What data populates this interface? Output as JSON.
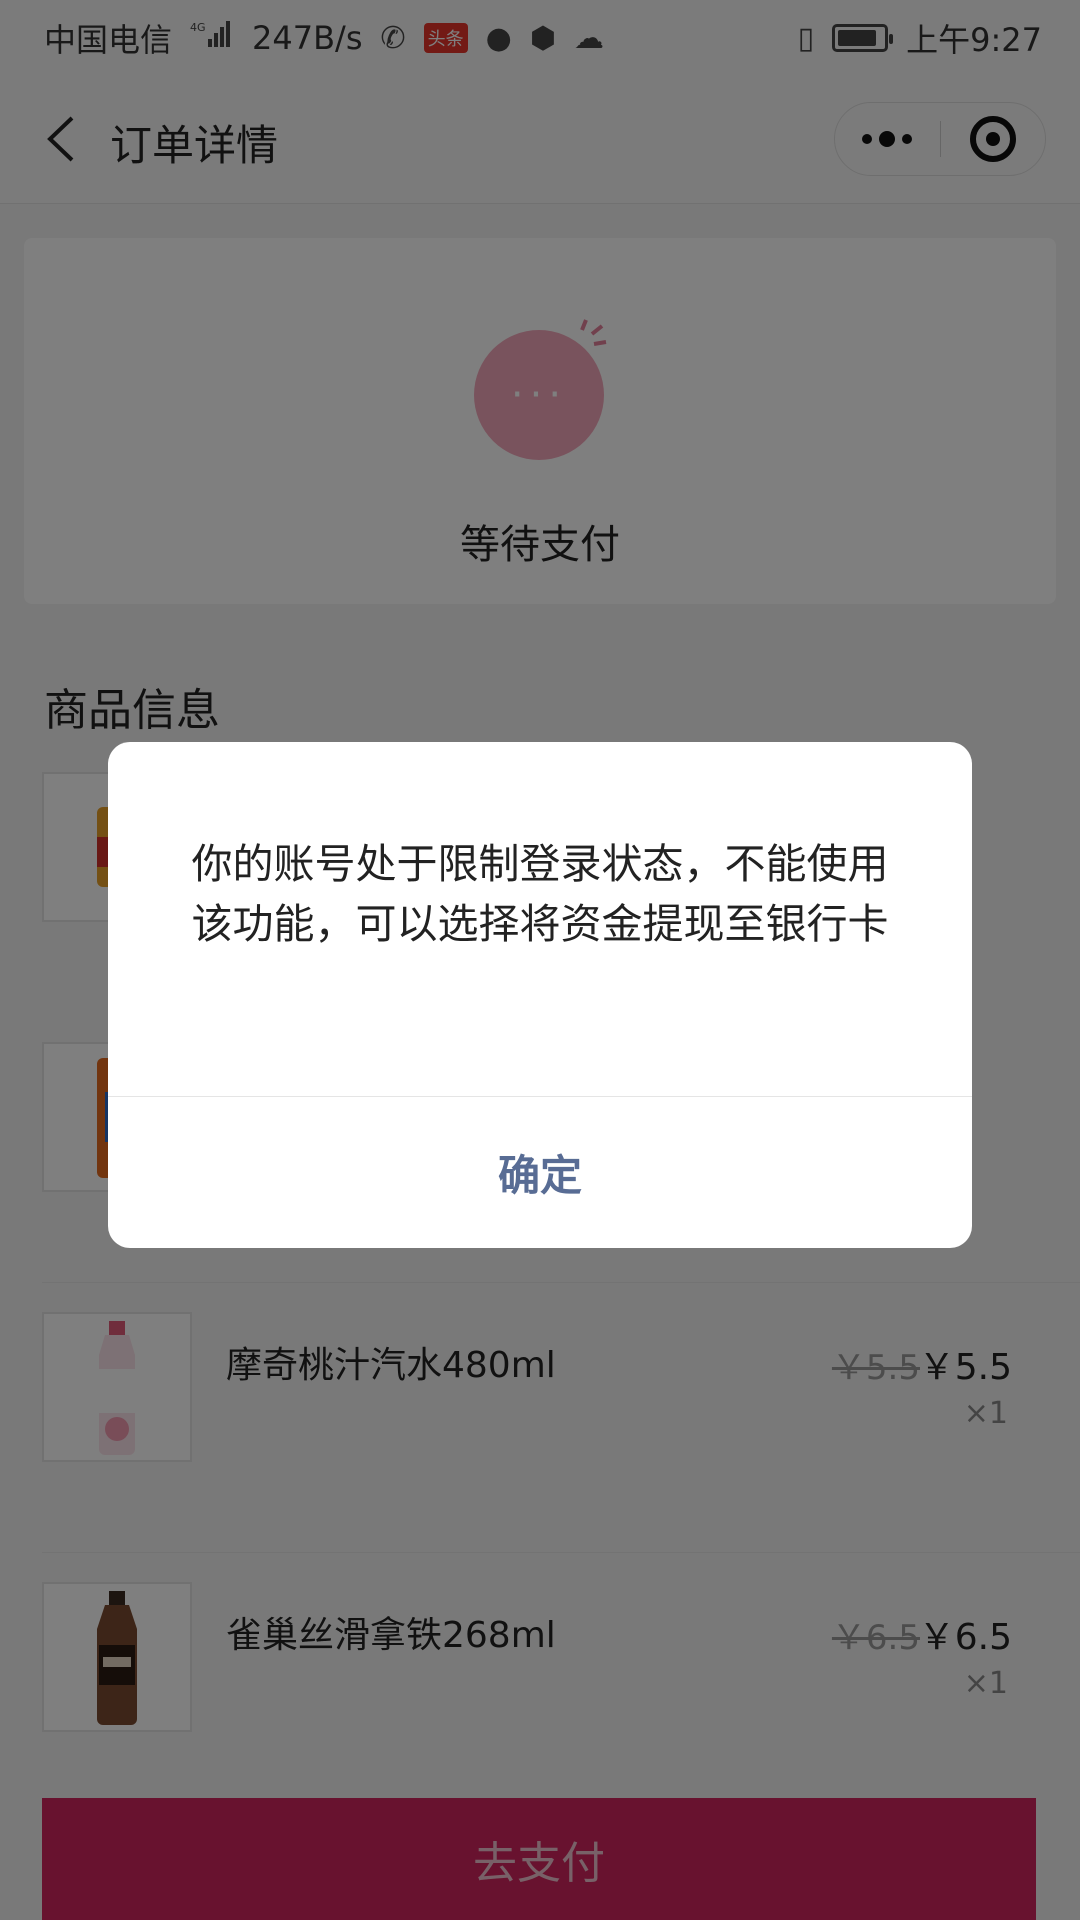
{
  "status_bar": {
    "carrier": "中国电信",
    "network": "4G",
    "speed": "247B/s",
    "badge": "头条",
    "time": "上午9:27",
    "battery_level": 0.85
  },
  "nav": {
    "title": "订单详情",
    "back_icon": "chevron-left-icon",
    "more_icon": "more-icon",
    "close_icon": "target-close-icon"
  },
  "order_status": {
    "icon_text": "···",
    "label": "等待支付"
  },
  "products": {
    "section_title": "商品信息",
    "items": [
      {
        "name": "摩奇桃汁汽水480ml",
        "old_price": "￥5.5",
        "price": "￥5.5",
        "qty": "×1"
      },
      {
        "name": "雀巢丝滑拿铁268ml",
        "old_price": "￥6.5",
        "price": "￥6.5",
        "qty": "×1"
      }
    ]
  },
  "pay_button": "去支付",
  "dialog": {
    "message": "你的账号处于限制登录状态，不能使用该功能，可以选择将资金提现至银行卡",
    "confirm": "确定"
  },
  "colors": {
    "accent": "#d1245f",
    "dialog_button": "#586c94",
    "status_circle": "#f2a7ba"
  }
}
